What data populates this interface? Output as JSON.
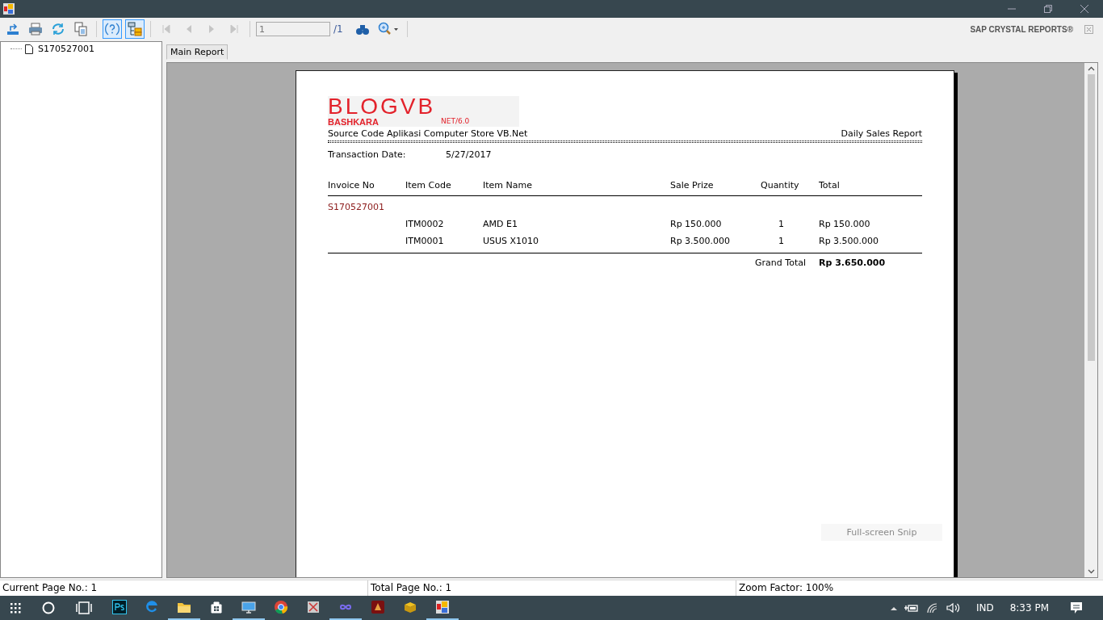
{
  "toolbar": {
    "buttons": [
      {
        "kind": "export",
        "selected": false,
        "disabled": false
      },
      {
        "kind": "print",
        "selected": false,
        "disabled": false
      },
      {
        "kind": "refresh",
        "selected": false,
        "disabled": false
      },
      {
        "kind": "copy",
        "selected": false,
        "disabled": false
      },
      {
        "kind": "help",
        "selected": true,
        "disabled": false
      },
      {
        "kind": "tree",
        "selected": true,
        "disabled": false
      },
      {
        "kind": "first",
        "selected": false,
        "disabled": true
      },
      {
        "kind": "prev",
        "selected": false,
        "disabled": true
      },
      {
        "kind": "next",
        "selected": false,
        "disabled": true
      },
      {
        "kind": "last",
        "selected": false,
        "disabled": true
      }
    ],
    "page_field": {
      "value": "1"
    },
    "page_total": "/1",
    "brand": "SAP CRYSTAL REPORTS®"
  },
  "tree": {
    "items": [
      {
        "label": "S170527001",
        "selected": false
      }
    ]
  },
  "tabs": [
    {
      "label": "Main Report",
      "selected": true
    }
  ],
  "report": {
    "logo": {
      "main": "BLOGVB",
      "sub": "BASHKARA",
      "version": "NET/6.0"
    },
    "subtitle": "Source Code Aplikasi Computer Store VB.Net",
    "title": "Daily Sales Report",
    "date_label": "Transaction Date:",
    "date_value": "5/27/2017",
    "columns": [
      "Invoice No",
      "Item Code",
      "Item Name",
      "Sale Prize",
      "Quantity",
      "Total"
    ],
    "groups": [
      {
        "invoice": "S170527001",
        "rows": [
          {
            "code": "ITM0002",
            "name": "AMD E1",
            "price": "Rp 150.000",
            "qty": "1",
            "total": "Rp 150.000"
          },
          {
            "code": "ITM0001",
            "name": "USUS X1010",
            "price": "Rp 3.500.000",
            "qty": "1",
            "total": "Rp 3.500.000"
          }
        ]
      }
    ],
    "grand_total_label": "Grand Total",
    "grand_total": "Rp 3.650.000"
  },
  "toast": "Full-screen Snip",
  "status_bar": [
    "Current Page No.: 1",
    "Total Page No.: 1",
    "Zoom Factor: 100%"
  ],
  "taskbar": {
    "apps": [
      {
        "kind": "ps",
        "running": false
      },
      {
        "kind": "edge",
        "running": false
      },
      {
        "kind": "folder",
        "running": true
      },
      {
        "kind": "store",
        "running": false
      },
      {
        "kind": "monitor",
        "running": true
      },
      {
        "kind": "chrome",
        "running": false
      },
      {
        "kind": "tool",
        "running": false
      },
      {
        "kind": "infinity",
        "running": true
      },
      {
        "kind": "game",
        "running": false
      },
      {
        "kind": "archive",
        "running": false
      },
      {
        "kind": "crystal",
        "running": true
      }
    ],
    "language": "IND",
    "time": "8:33 PM"
  }
}
